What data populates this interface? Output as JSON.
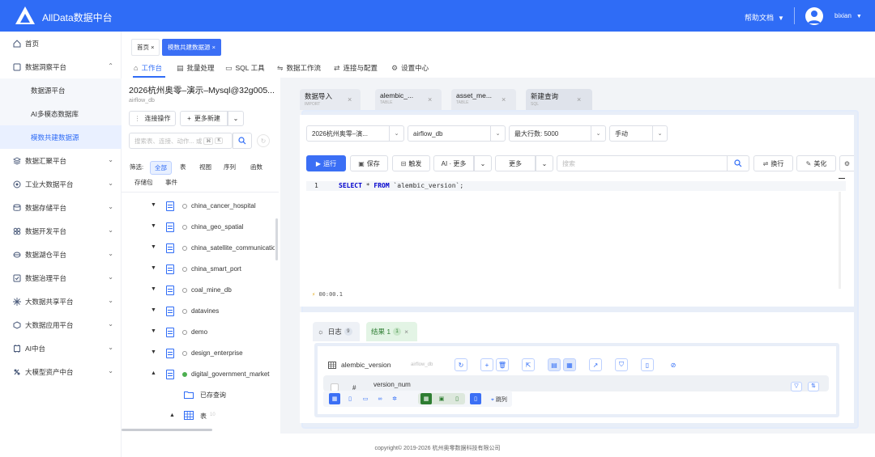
{
  "app": {
    "title": "AllData数据中台",
    "help": "帮助文档",
    "user": "bixian"
  },
  "sidebar": {
    "items": [
      {
        "label": "首页",
        "icon": "home-icon"
      },
      {
        "label": "数据洞察平台",
        "icon": "insight-icon",
        "expanded": true
      },
      {
        "label": "数据汇聚平台",
        "icon": "converge-icon"
      },
      {
        "label": "工业大数据平台",
        "icon": "industry-icon"
      },
      {
        "label": "数据存储平台",
        "icon": "storage-icon"
      },
      {
        "label": "数据开发平台",
        "icon": "develop-icon"
      },
      {
        "label": "数据湖仓平台",
        "icon": "lakehouse-icon"
      },
      {
        "label": "数据治理平台",
        "icon": "governance-icon"
      },
      {
        "label": "大数据共享平台",
        "icon": "share-icon"
      },
      {
        "label": "大数据应用平台",
        "icon": "application-icon"
      },
      {
        "label": "AI中台",
        "icon": "ai-icon"
      },
      {
        "label": "大模型资产中台",
        "icon": "model-icon"
      }
    ],
    "subitems": [
      {
        "label": "数据源平台"
      },
      {
        "label": "AI多模态数据库"
      },
      {
        "label": "模数共建数据源",
        "active": true
      }
    ]
  },
  "page_tabs": [
    {
      "label": "首页"
    },
    {
      "label": "模数共建数据源",
      "active": true
    }
  ],
  "tool_nav": [
    {
      "label": "工作台",
      "icon": "home-icon",
      "active": true
    },
    {
      "label": "批量处理",
      "icon": "batch-icon"
    },
    {
      "label": "SQL 工具",
      "icon": "sql-icon"
    },
    {
      "label": "数据工作流",
      "icon": "workflow-icon"
    },
    {
      "label": "连接与配置",
      "icon": "link-icon"
    },
    {
      "label": "设置中心",
      "icon": "settings-icon"
    }
  ],
  "datasource": {
    "name": "2026杭州奥零–演示–Mysql@32g005...",
    "db": "airflow_db",
    "connect_op": "连接操作",
    "more_new": "更多新建",
    "search_placeholder": "搜索表、连接、动作... 或",
    "kbd1": "⌘",
    "kbd2": "K"
  },
  "filters": {
    "prefix": "筛选:",
    "items": [
      "全部",
      "表",
      "视图",
      "序列",
      "函数",
      "存储包",
      "事件"
    ]
  },
  "tree": [
    {
      "name": "china_cancer_hospital"
    },
    {
      "name": "china_geo_spatial"
    },
    {
      "name": "china_satellite_communications"
    },
    {
      "name": "china_smart_port"
    },
    {
      "name": "coal_mine_db"
    },
    {
      "name": "datavines"
    },
    {
      "name": "demo"
    },
    {
      "name": "design_enterprise"
    },
    {
      "name": "digital_government_market",
      "expanded": true,
      "connected": true
    }
  ],
  "tree_children": {
    "saved": "已存查询",
    "tables": "表",
    "tables_count": "10"
  },
  "query_tabs": [
    {
      "title": "数据导入",
      "sub": "IMPORT"
    },
    {
      "title": "alembic_...",
      "sub": "TABLE"
    },
    {
      "title": "asset_me...",
      "sub": "TABLE"
    },
    {
      "title": "新建查询",
      "sub": "SQL",
      "active": true
    }
  ],
  "editor": {
    "ds_select": "2026杭州奥零–演...",
    "db_select": "airflow_db",
    "max_rows": "最大行数: 5000",
    "mode": "手动",
    "run": "运行",
    "save": "保存",
    "trigger": "触发",
    "ai_more": "AI · 更多",
    "more": "更多",
    "search_placeholder": "搜索",
    "wrap": "换行",
    "beautify": "美化",
    "line_no": "1",
    "sql_kw1": "SELECT",
    "sql_star": "*",
    "sql_kw2": "FROM",
    "sql_rest": "`alembic_version`;",
    "timer": "00:00.1"
  },
  "result": {
    "log_tab": "日志",
    "log_count": "9",
    "result_tab": "结果 1",
    "result_count": "1",
    "table_name": "alembic_version",
    "db_name": "airflow_db",
    "col_hash": "#",
    "col_name": "version_num",
    "jump": "跳列"
  },
  "footer": {
    "copyright": "copyright© 2019-2026 杭州奥零数据科技有限公司"
  },
  "colors": {
    "primary": "#2f6cf6",
    "success": "#4caf50"
  }
}
